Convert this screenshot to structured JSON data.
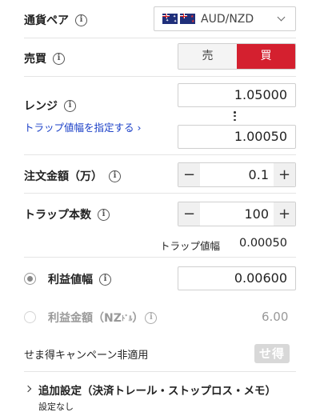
{
  "currency_pair": {
    "label": "通貨ペア",
    "selected": "AUD/NZD"
  },
  "side": {
    "label": "売買",
    "sell": "売",
    "buy": "買",
    "active": "buy"
  },
  "range": {
    "label": "レンジ",
    "upper_value": "1.05000",
    "lower_value": "1.00050",
    "trap_width_link": "トラップ値幅を指定する ›"
  },
  "order_amount": {
    "label": "注文金額（万）",
    "value": "0.1",
    "minus": "−",
    "plus": "+"
  },
  "trap_count": {
    "label": "トラップ本数",
    "value": "100",
    "minus": "−",
    "plus": "+"
  },
  "trap_width": {
    "label": "トラップ値幅",
    "value": "0.00050"
  },
  "profit_width": {
    "label": "利益値幅",
    "value": "0.00600",
    "selected": true
  },
  "profit_amount": {
    "label": "利益金額（NZ",
    "unit": "ﾄﾞﾙ",
    "label_end": "）",
    "value": "6.00",
    "selected": false
  },
  "campaign": {
    "text": "せま得キャンペーン非適用",
    "badge": "せ得"
  },
  "additional": {
    "title": "追加設定（決済トレール・ストップロス・メモ）",
    "subtitle": "設定なし"
  },
  "colors": {
    "buy_active": "#d4202f",
    "link": "#1a3fc7",
    "muted": "#999999"
  }
}
